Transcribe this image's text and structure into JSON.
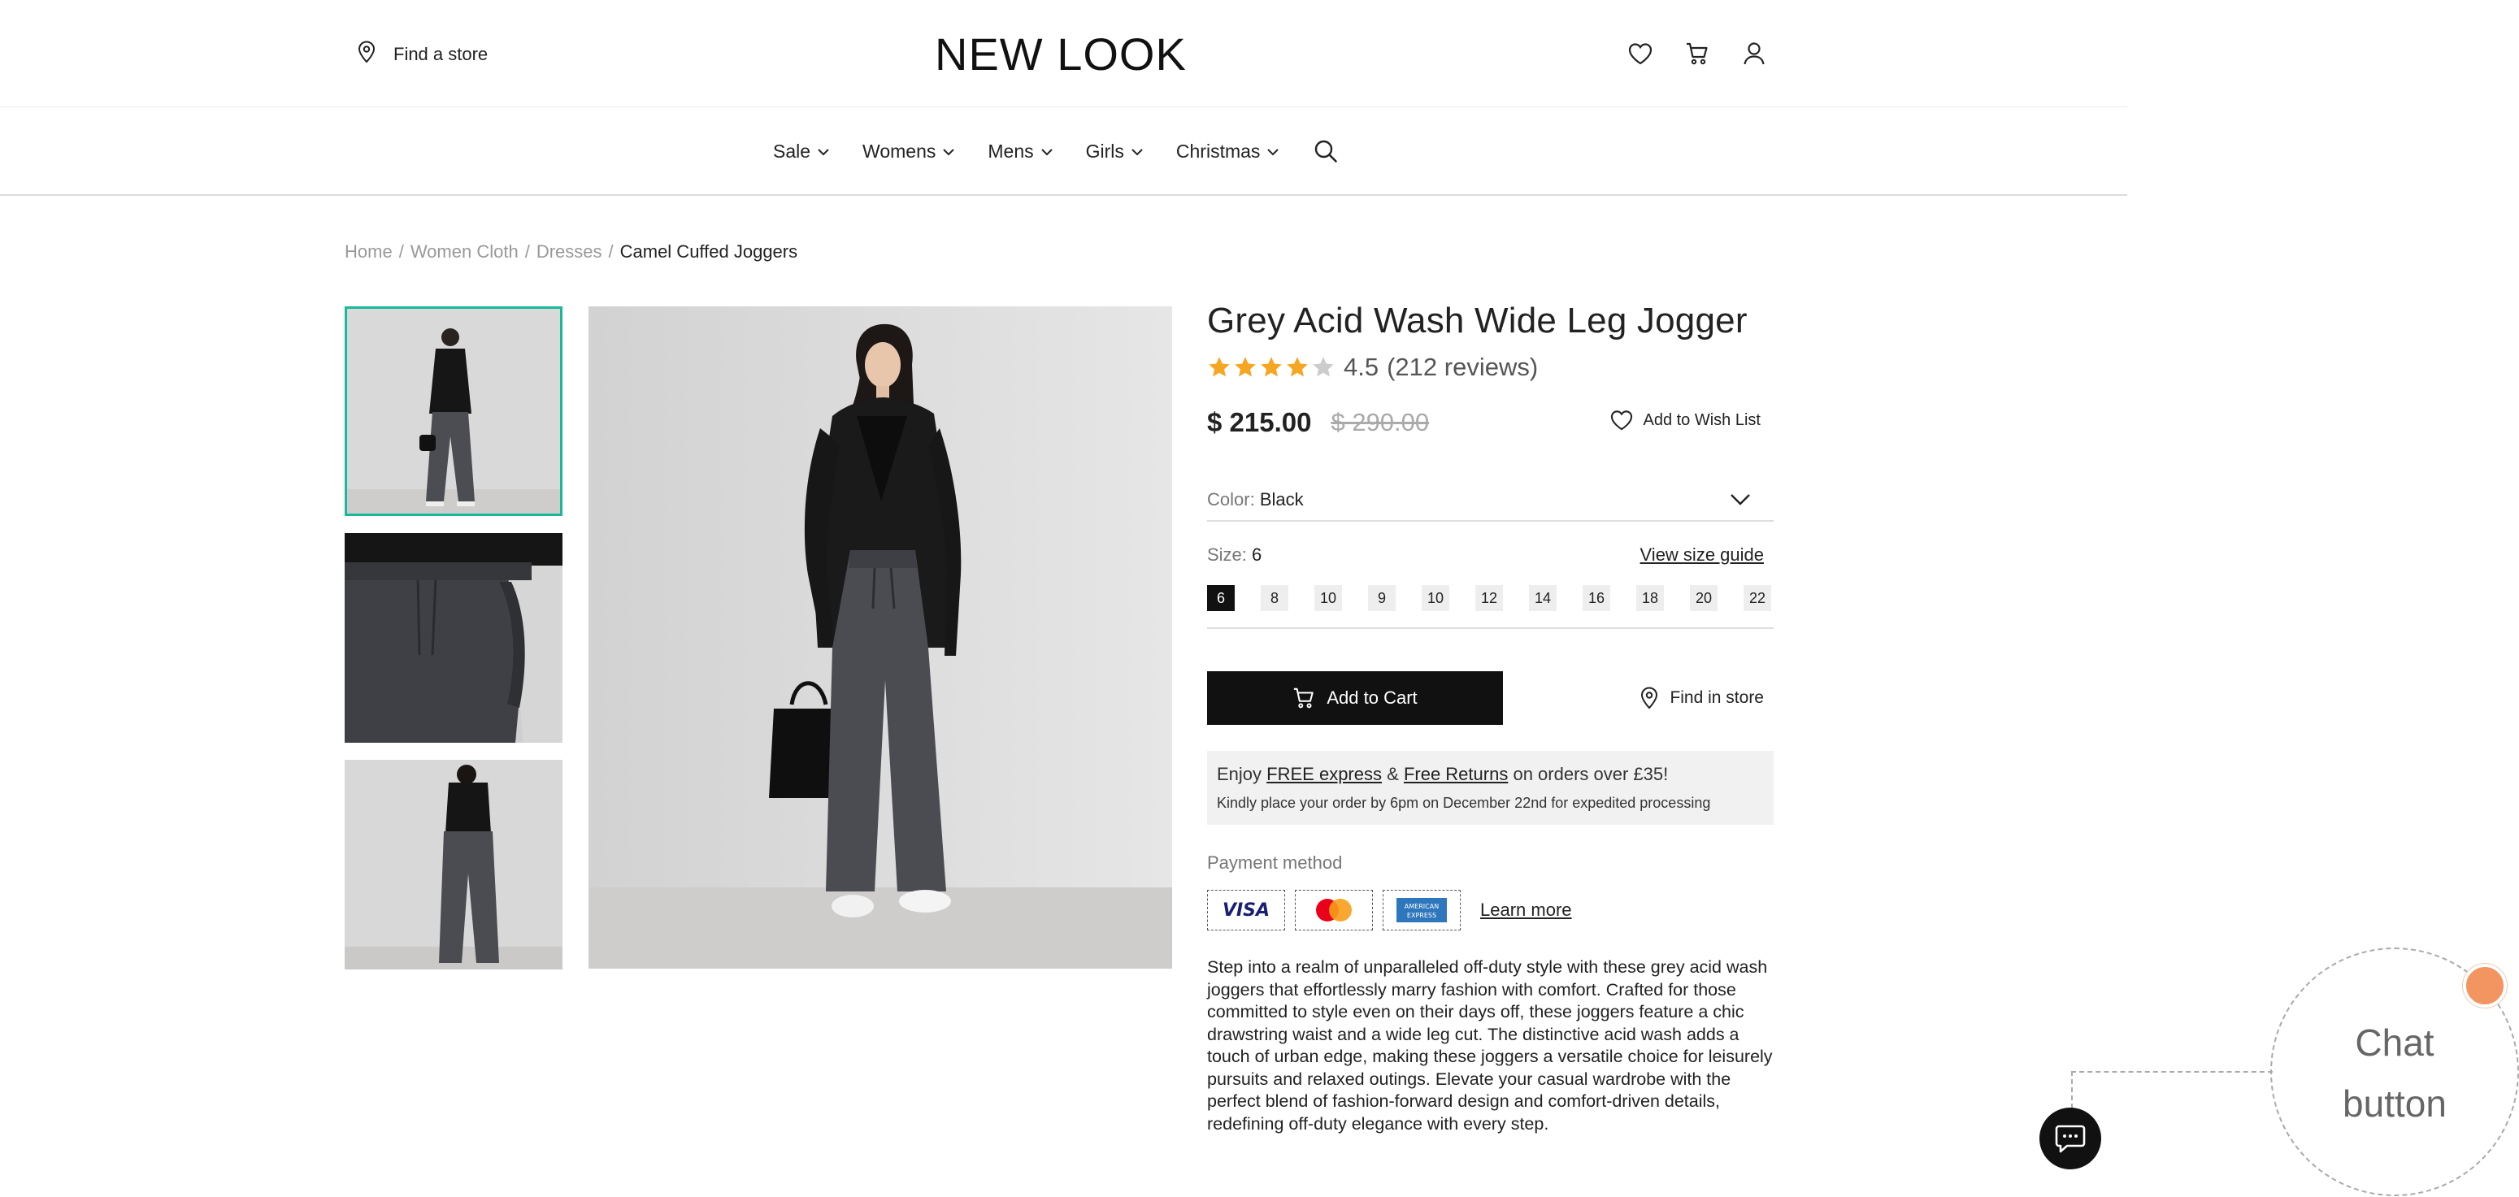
{
  "header": {
    "find_store_label": "Find a store",
    "logo": "NEW LOOK",
    "icons": [
      "heart-icon",
      "cart-icon",
      "user-icon"
    ]
  },
  "nav": {
    "items": [
      {
        "label": "Sale"
      },
      {
        "label": "Womens"
      },
      {
        "label": "Mens"
      },
      {
        "label": "Girls"
      },
      {
        "label": "Christmas"
      }
    ]
  },
  "breadcrumb": {
    "items": [
      "Home",
      "Women Cloth",
      "Dresses"
    ],
    "separator": "/",
    "current": "Camel Cuffed Joggers"
  },
  "product": {
    "title": "Grey Acid Wash Wide Leg Jogger",
    "rating": "4.5",
    "rating_value": 4.5,
    "reviews": "(212 reviews)",
    "price": "$ 215.00",
    "old_price": "$ 290.00",
    "wishlist_label": "Add to Wish List",
    "color_label": "Color:",
    "color_value": "Black",
    "size_label": "Size:",
    "size_value": "6",
    "size_guide": "View size guide",
    "sizes": [
      "6",
      "8",
      "10",
      "9",
      "10",
      "12",
      "14",
      "16",
      "18",
      "20",
      "22"
    ],
    "selected_size_index": 0,
    "add_to_cart": "Add to Cart",
    "find_in_store": "Find in store",
    "shipping": {
      "enjoy": "Enjoy",
      "free_express": "FREE express",
      "amp": "&",
      "free_returns": "Free Returns",
      "suffix": "on orders over £35!",
      "note": "Kindly place your order by 6pm on December 22nd for expedited processing"
    },
    "payment_label": "Payment method",
    "payment_cards": [
      "VISA",
      "mastercard",
      "AMERICAN EXPRESS"
    ],
    "learn_more": "Learn more",
    "description": "Step into a realm of unparalleled off-duty style with these grey acid wash joggers that effortlessly marry fashion with comfort. Crafted for those committed to style even on their days off, these joggers feature a chic drawstring waist and a wide leg cut. The distinctive acid wash adds a touch of urban edge, making these joggers a versatile choice for leisurely pursuits and relaxed outings. Elevate your casual wardrobe with the perfect blend of fashion-forward design and comfort-driven details, redefining off-duty elegance with every step."
  },
  "annotation": {
    "label_line1": "Chat",
    "label_line2": "button"
  },
  "colors": {
    "accent_thumb_border": "#18b89a",
    "star": "#f5a623",
    "star_empty": "#cccccc",
    "button_bg": "#111111",
    "annotation_dot": "#f29561"
  }
}
